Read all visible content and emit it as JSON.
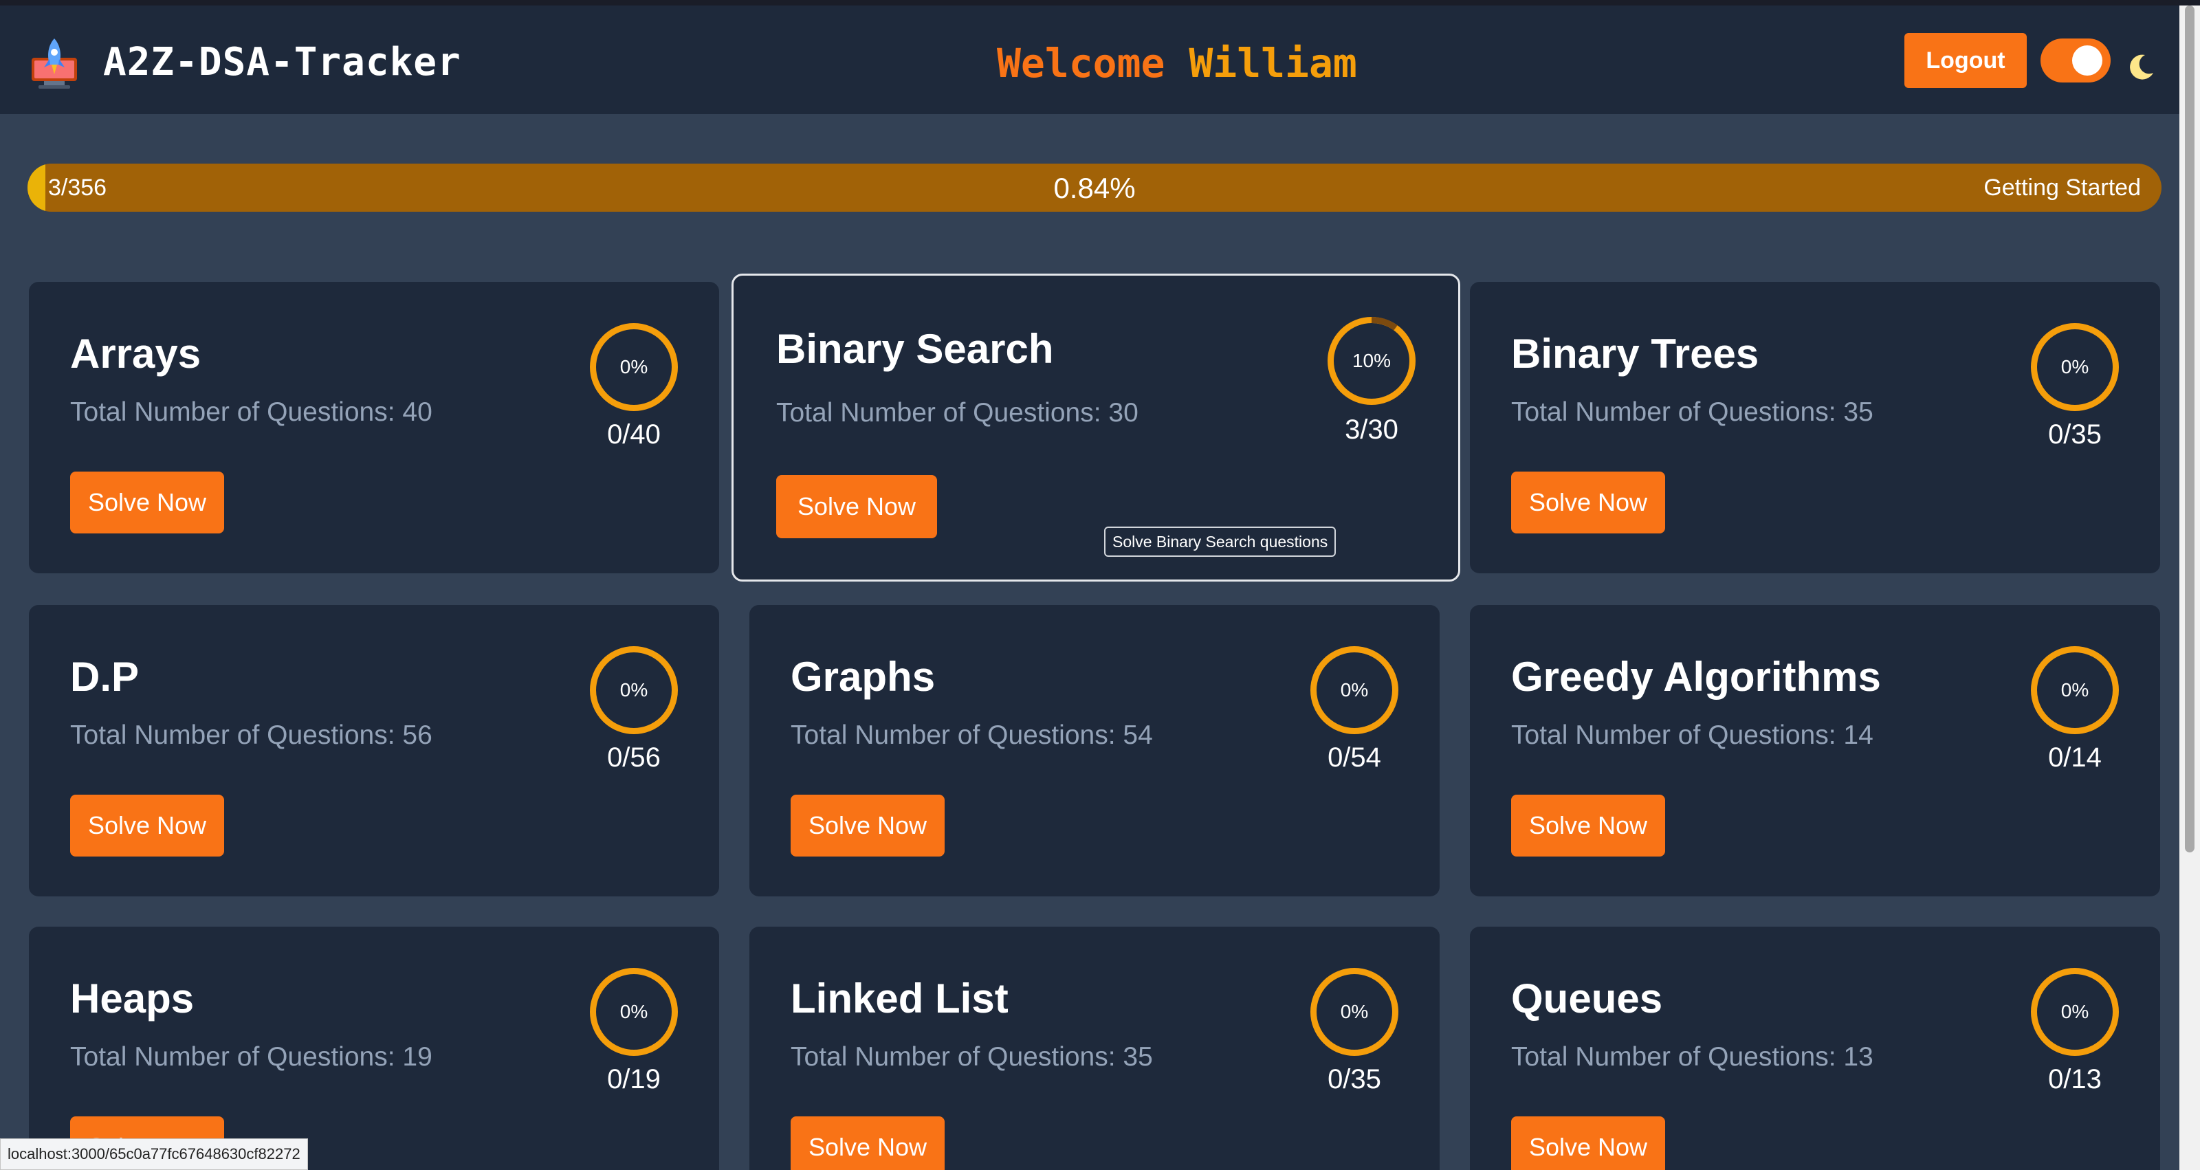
{
  "header": {
    "app_title": "A2Z-DSA-Tracker",
    "welcome_prefix": "Welcome",
    "user_name": "William",
    "logout_label": "Logout",
    "theme_toggle_on": true,
    "theme_icon": "moon-icon",
    "logo_icon": "rocket-icon"
  },
  "overall_progress": {
    "count": "3/356",
    "percent_label": "0.84%",
    "fraction": 0.0084,
    "level": "Getting Started"
  },
  "colors": {
    "accent": "#f97316",
    "ring": "#f59e0b",
    "card_bg": "#1e293b",
    "page_bg": "#334155",
    "progress_track": "#a16207",
    "progress_fill": "#eab308"
  },
  "cards": [
    {
      "title": "Arrays",
      "subtitle": "Total Number of Questions: 40",
      "percent": "0%",
      "fraction": 0.0,
      "ratio": "0/40",
      "button": "Solve Now"
    },
    {
      "title": "Binary Search",
      "subtitle": "Total Number of Questions: 30",
      "percent": "10%",
      "fraction": 0.1,
      "ratio": "3/30",
      "button": "Solve Now"
    },
    {
      "title": "Binary Trees",
      "subtitle": "Total Number of Questions: 35",
      "percent": "0%",
      "fraction": 0.0,
      "ratio": "0/35",
      "button": "Solve Now"
    },
    {
      "title": "D.P",
      "subtitle": "Total Number of Questions: 56",
      "percent": "0%",
      "fraction": 0.0,
      "ratio": "0/56",
      "button": "Solve Now"
    },
    {
      "title": "Graphs",
      "subtitle": "Total Number of Questions: 54",
      "percent": "0%",
      "fraction": 0.0,
      "ratio": "0/54",
      "button": "Solve Now"
    },
    {
      "title": "Greedy Algorithms",
      "subtitle": "Total Number of Questions: 14",
      "percent": "0%",
      "fraction": 0.0,
      "ratio": "0/14",
      "button": "Solve Now"
    },
    {
      "title": "Heaps",
      "subtitle": "Total Number of Questions: 19",
      "percent": "0%",
      "fraction": 0.0,
      "ratio": "0/19",
      "button": "Solve Now"
    },
    {
      "title": "Linked List",
      "subtitle": "Total Number of Questions: 35",
      "percent": "0%",
      "fraction": 0.0,
      "ratio": "0/35",
      "button": "Solve Now"
    },
    {
      "title": "Queues",
      "subtitle": "Total Number of Questions: 13",
      "percent": "0%",
      "fraction": 0.0,
      "ratio": "0/13",
      "button": "Solve Now"
    }
  ],
  "tooltip": "Solve Binary Search questions",
  "status_bar_url": "localhost:3000/65c0a77fc67648630cf82272"
}
